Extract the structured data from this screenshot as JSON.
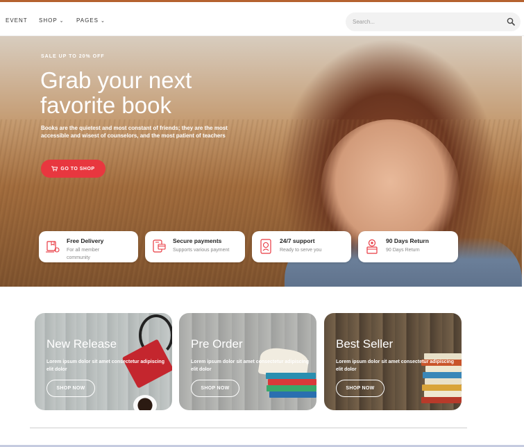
{
  "nav": {
    "items": [
      {
        "label": "EVENT",
        "has_menu": false
      },
      {
        "label": "SHOP",
        "has_menu": true
      },
      {
        "label": "PAGES",
        "has_menu": true
      }
    ],
    "search_placeholder": "Search..."
  },
  "hero": {
    "eyebrow": "SALE UP TO 20% OFF",
    "title": "Grab your next favorite book",
    "text": "Books are the quietest and most constant of friends; they are the most accessible and wisest of counselors, and the most patient of teachers",
    "button_label": "GO TO SHOP"
  },
  "features": [
    {
      "title": "Free Delivery",
      "subtitle": "For all member community",
      "icon": "delivery-icon"
    },
    {
      "title": "Secure payments",
      "subtitle": "Supports various payment",
      "icon": "payment-icon"
    },
    {
      "title": "24/7 support",
      "subtitle": "Ready to serve you",
      "icon": "support-icon"
    },
    {
      "title": "90 Days Return",
      "subtitle": "90 Days Return",
      "icon": "return-icon"
    }
  ],
  "categories": [
    {
      "title": "New Release",
      "text": "Lorem ipsum dolor sit amet consectetur adipiscing elit dolor",
      "button_label": "SHOP NOW"
    },
    {
      "title": "Pre Order",
      "text": "Lorem ipsum dolor sit amet consectetur adipiscing elit dolor",
      "button_label": "SHOP NOW"
    },
    {
      "title": "Best Seller",
      "text": "Lorem ipsum dolor sit amet consectetur adipiscing elit dolor",
      "button_label": "SHOP NOW"
    }
  ],
  "colors": {
    "accent": "#e8373f",
    "top_accent": "#b5622f"
  }
}
